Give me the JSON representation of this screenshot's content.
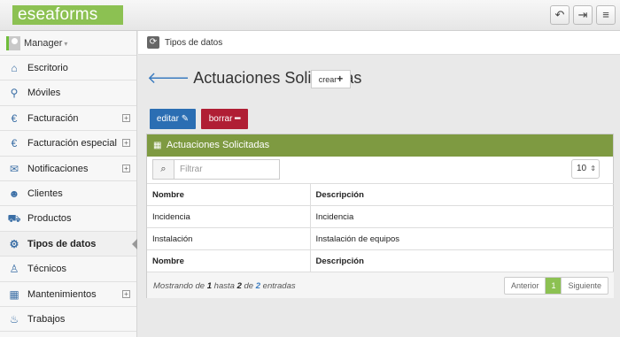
{
  "app": {
    "logo": "eseaforms"
  },
  "topbar": {
    "back_icon": "undo-icon",
    "logout_icon": "sign-out-icon",
    "menu_icon": "menu-icon"
  },
  "user": {
    "name": "Manager"
  },
  "sidebar": {
    "items": [
      {
        "label": "Escritorio",
        "icon": "home-icon"
      },
      {
        "label": "Móviles",
        "icon": "android-icon"
      },
      {
        "label": "Facturación",
        "icon": "euro-icon",
        "expandable": true
      },
      {
        "label": "Facturación especial",
        "icon": "euro-icon",
        "expandable": true
      },
      {
        "label": "Notificaciones",
        "icon": "envelope-icon",
        "expandable": true
      },
      {
        "label": "Clientes",
        "icon": "users-icon"
      },
      {
        "label": "Productos",
        "icon": "cart-icon"
      },
      {
        "label": "Tipos de datos",
        "icon": "gears-icon",
        "active": true
      },
      {
        "label": "Técnicos",
        "icon": "person-icon"
      },
      {
        "label": "Mantenimientos",
        "icon": "calendar-icon",
        "expandable": true
      },
      {
        "label": "Trabajos",
        "icon": "fire-icon"
      }
    ]
  },
  "breadcrumb": {
    "label": "Tipos de datos"
  },
  "page": {
    "title": "Actuaciones Solicitadas",
    "create_label": "crear"
  },
  "actions": {
    "edit_label": "editar",
    "delete_label": "borrar"
  },
  "panel": {
    "title": "Actuaciones Solicitadas",
    "search_placeholder": "Filtrar",
    "page_size": "10",
    "columns": [
      "Nombre",
      "Descripción"
    ],
    "rows": [
      [
        "Incidencia",
        "Incidencia"
      ],
      [
        "Instalación",
        "Instalación de equipos"
      ]
    ],
    "footer_columns": [
      "Nombre",
      "Descripción"
    ],
    "info": {
      "prefix": "Mostrando de",
      "from": "1",
      "mid": "hasta",
      "to": "2",
      "of": "de",
      "total": "2",
      "suffix": "entradas"
    },
    "pager": {
      "prev": "Anterior",
      "current": "1",
      "next": "Siguiente"
    }
  },
  "colors": {
    "brand": "#8cc152",
    "panel_header": "#7e9a41",
    "edit": "#2b6eb3",
    "delete": "#b01e34"
  }
}
